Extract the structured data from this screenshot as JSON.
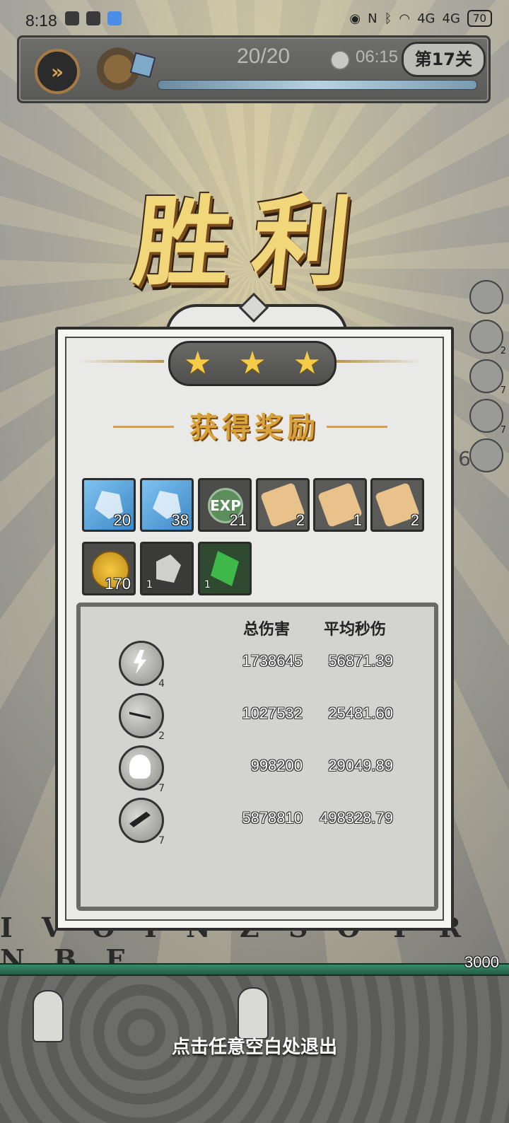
{
  "status_bar": {
    "time": "8:18",
    "network_1": "4G",
    "network_2": "4G",
    "battery": "70"
  },
  "hud": {
    "fast_forward_icon": "fast-forward-icon",
    "wave": "20/20",
    "timer": "06:15",
    "level": "第17关"
  },
  "victory_text": "胜利",
  "stars": {
    "earned": 3,
    "total": 3
  },
  "reward_title": "获得奖励",
  "rewards": [
    {
      "icon": "blue-crystal-chest-icon",
      "qty": "20"
    },
    {
      "icon": "blue-crystal-shelf-icon",
      "qty": "38"
    },
    {
      "icon": "exp-orb-icon",
      "label": "EXP",
      "qty": "21"
    },
    {
      "icon": "boot-scroll-icon",
      "qty": "2"
    },
    {
      "icon": "armor-scroll-icon",
      "qty": "1"
    },
    {
      "icon": "ring-scroll-icon",
      "qty": "2"
    },
    {
      "icon": "gold-coin-icon",
      "qty": "170"
    },
    {
      "icon": "gray-stone-icon",
      "qty": "1"
    },
    {
      "icon": "green-gem-icon",
      "qty": "1"
    }
  ],
  "stats": {
    "header_total": "总伤害",
    "header_dps": "平均秒伤",
    "rows": [
      {
        "icon": "lightning-skill-icon",
        "level": "4",
        "total": "1738645",
        "dps": "56871.39"
      },
      {
        "icon": "slash-skill-icon",
        "level": "2",
        "total": "1027532",
        "dps": "25481.60"
      },
      {
        "icon": "ghost-skill-icon",
        "level": "7",
        "total": "998200",
        "dps": "29049.89"
      },
      {
        "icon": "meteor-skill-icon",
        "level": "7",
        "total": "5878810",
        "dps": "498328.79"
      }
    ]
  },
  "side_skill_levels": [
    "",
    "2",
    "7",
    "7"
  ],
  "side_counter": "6",
  "runes": "I V O I N Z S O T R N B F",
  "base_hp": "3000",
  "exit_hint": "点击任意空白处退出"
}
